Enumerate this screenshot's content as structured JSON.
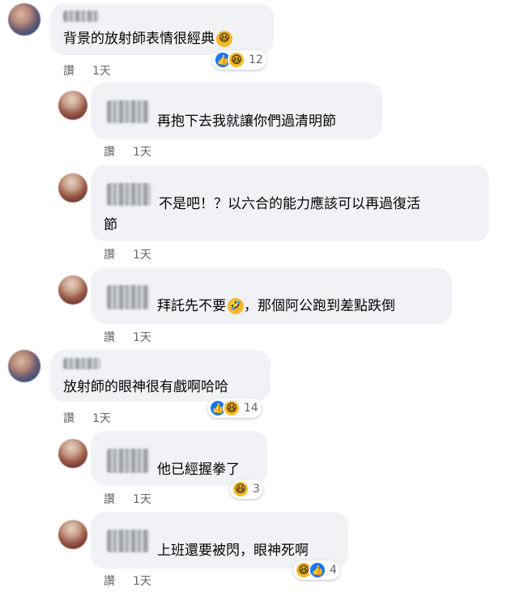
{
  "comments": [
    {
      "name": "",
      "text": "背景的放射師表情很經典",
      "emoji": "😆",
      "meta_label": "讚",
      "meta_time": "1天",
      "reactions": [
        "like",
        "haha"
      ],
      "reaction_count": "12"
    },
    {
      "name": "",
      "text": "再抱下去我就讓你們過清明節",
      "meta_label": "讚",
      "meta_time": "1天"
    },
    {
      "name": "",
      "text_line1": "不是吧！？以六合的能力應該可以再過復活",
      "text_line2": "節",
      "meta_label": "讚",
      "meta_time": "1天"
    },
    {
      "name": "",
      "text_pre": "拜託先不要",
      "emoji": "🤣",
      "text_post": "，那個阿公跑到差點跌倒",
      "meta_label": "讚",
      "meta_time": "1天"
    },
    {
      "name": "",
      "text": "放射師的眼神很有戲啊哈哈",
      "meta_label": "讚",
      "meta_time": "1天",
      "reactions": [
        "like",
        "haha"
      ],
      "reaction_count": "14"
    },
    {
      "name": "",
      "text": "他已經握拳了",
      "meta_label": "讚",
      "meta_time": "1天",
      "reactions": [
        "haha"
      ],
      "reaction_count": "3"
    },
    {
      "name": "",
      "text": "上班還要被閃，眼神死啊",
      "meta_label": "讚",
      "meta_time": "1天",
      "reactions": [
        "haha",
        "like"
      ],
      "reaction_count": "4"
    }
  ],
  "colors": {
    "bubble": "#f0f2f5",
    "meta": "#65676b",
    "like": "#1877f2",
    "haha": "#f7b928"
  },
  "icons": {
    "like": "thumbs-up-icon",
    "haha": "laughing-face-icon"
  }
}
